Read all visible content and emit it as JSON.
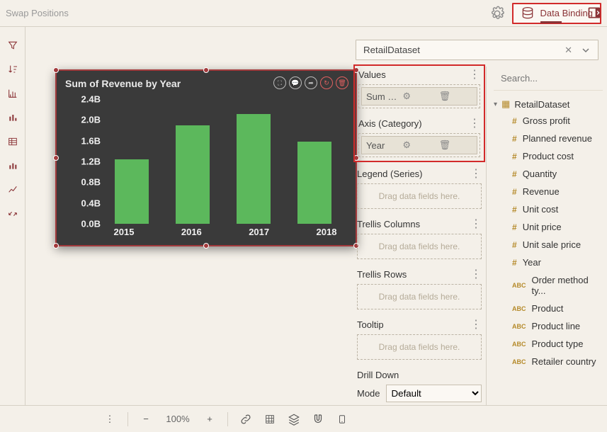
{
  "top": {
    "swap_label": "Swap Positions",
    "data_binding_label": "Data Binding"
  },
  "dataset": {
    "name": "RetailDataset",
    "search_placeholder": "Search..."
  },
  "chart_data": {
    "type": "bar",
    "title": "Sum of Revenue by Year",
    "categories": [
      "2015",
      "2016",
      "2017",
      "2018"
    ],
    "values": [
      1.24,
      1.9,
      2.11,
      1.58
    ],
    "ylim": [
      0.0,
      2.4
    ],
    "y_ticks": [
      "2.4B",
      "2.0B",
      "1.6B",
      "1.2B",
      "0.8B",
      "0.4B",
      "0.0B"
    ],
    "ylabel": "",
    "xlabel": ""
  },
  "panel": {
    "values": {
      "title": "Values",
      "chip": "Sum of Revenue"
    },
    "axis": {
      "title": "Axis (Category)",
      "chip": "Year"
    },
    "legend": {
      "title": "Legend (Series)",
      "hint": "Drag data fields here."
    },
    "trellis_cols": {
      "title": "Trellis Columns",
      "hint": "Drag data fields here."
    },
    "trellis_rows": {
      "title": "Trellis Rows",
      "hint": "Drag data fields here."
    },
    "tooltip": {
      "title": "Tooltip",
      "hint": "Drag data fields here."
    },
    "drill": {
      "title": "Drill Down",
      "mode_label": "Mode",
      "mode_value": "Default"
    }
  },
  "fields": [
    {
      "type": "num",
      "label": "Gross profit"
    },
    {
      "type": "num",
      "label": "Planned revenue"
    },
    {
      "type": "num",
      "label": "Product cost"
    },
    {
      "type": "num",
      "label": "Quantity"
    },
    {
      "type": "num",
      "label": "Revenue"
    },
    {
      "type": "num",
      "label": "Unit cost"
    },
    {
      "type": "num",
      "label": "Unit price"
    },
    {
      "type": "num",
      "label": "Unit sale price"
    },
    {
      "type": "num",
      "label": "Year"
    },
    {
      "type": "abc",
      "label": "Order method ty..."
    },
    {
      "type": "abc",
      "label": "Product"
    },
    {
      "type": "abc",
      "label": "Product line"
    },
    {
      "type": "abc",
      "label": "Product type"
    },
    {
      "type": "abc",
      "label": "Retailer country"
    }
  ],
  "bottom": {
    "zoom": "100%"
  }
}
